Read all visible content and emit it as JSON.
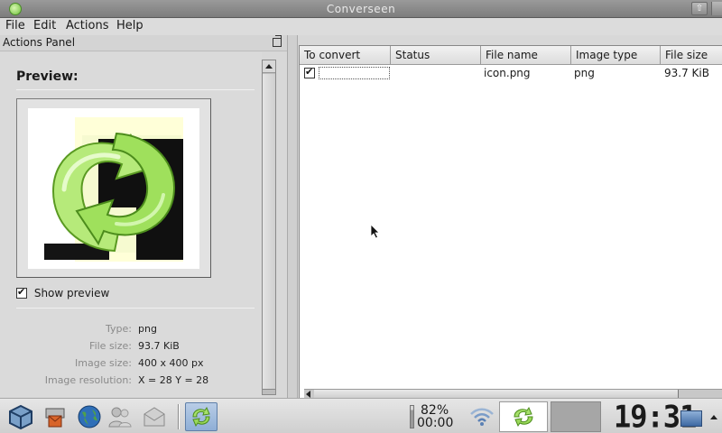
{
  "window": {
    "title": "Converseen"
  },
  "menu": {
    "file": "File",
    "edit": "Edit",
    "actions": "Actions",
    "help": "Help"
  },
  "actions_panel": {
    "title": "Actions Panel",
    "preview_label": "Preview:",
    "show_preview_label": "Show preview",
    "show_preview_checked": true,
    "info": {
      "type_label": "Type:",
      "type_value": "png",
      "filesize_label": "File size:",
      "filesize_value": "93.7 KiB",
      "imagesize_label": "Image size:",
      "imagesize_value": "400 x 400 px",
      "resolution_label": "Image resolution:",
      "resolution_value": "X = 28 Y = 28"
    }
  },
  "file_table": {
    "columns": [
      "To convert",
      "Status",
      "File name",
      "Image type",
      "File size"
    ],
    "rows": [
      {
        "to_convert": true,
        "status": "",
        "file_name": "icon.png",
        "image_type": "png",
        "file_size": "93.7 KiB"
      }
    ]
  },
  "taskbar": {
    "battery_percent": "82%",
    "battery_time": "00:00",
    "clock": "19:31",
    "launchers": [
      "cube-icon",
      "mail-printer-icon",
      "globe-icon",
      "users-icon",
      "envelope-icon"
    ]
  },
  "colors": {
    "accent_green": "#6cbf3a",
    "active_task": "#8eaed6"
  }
}
